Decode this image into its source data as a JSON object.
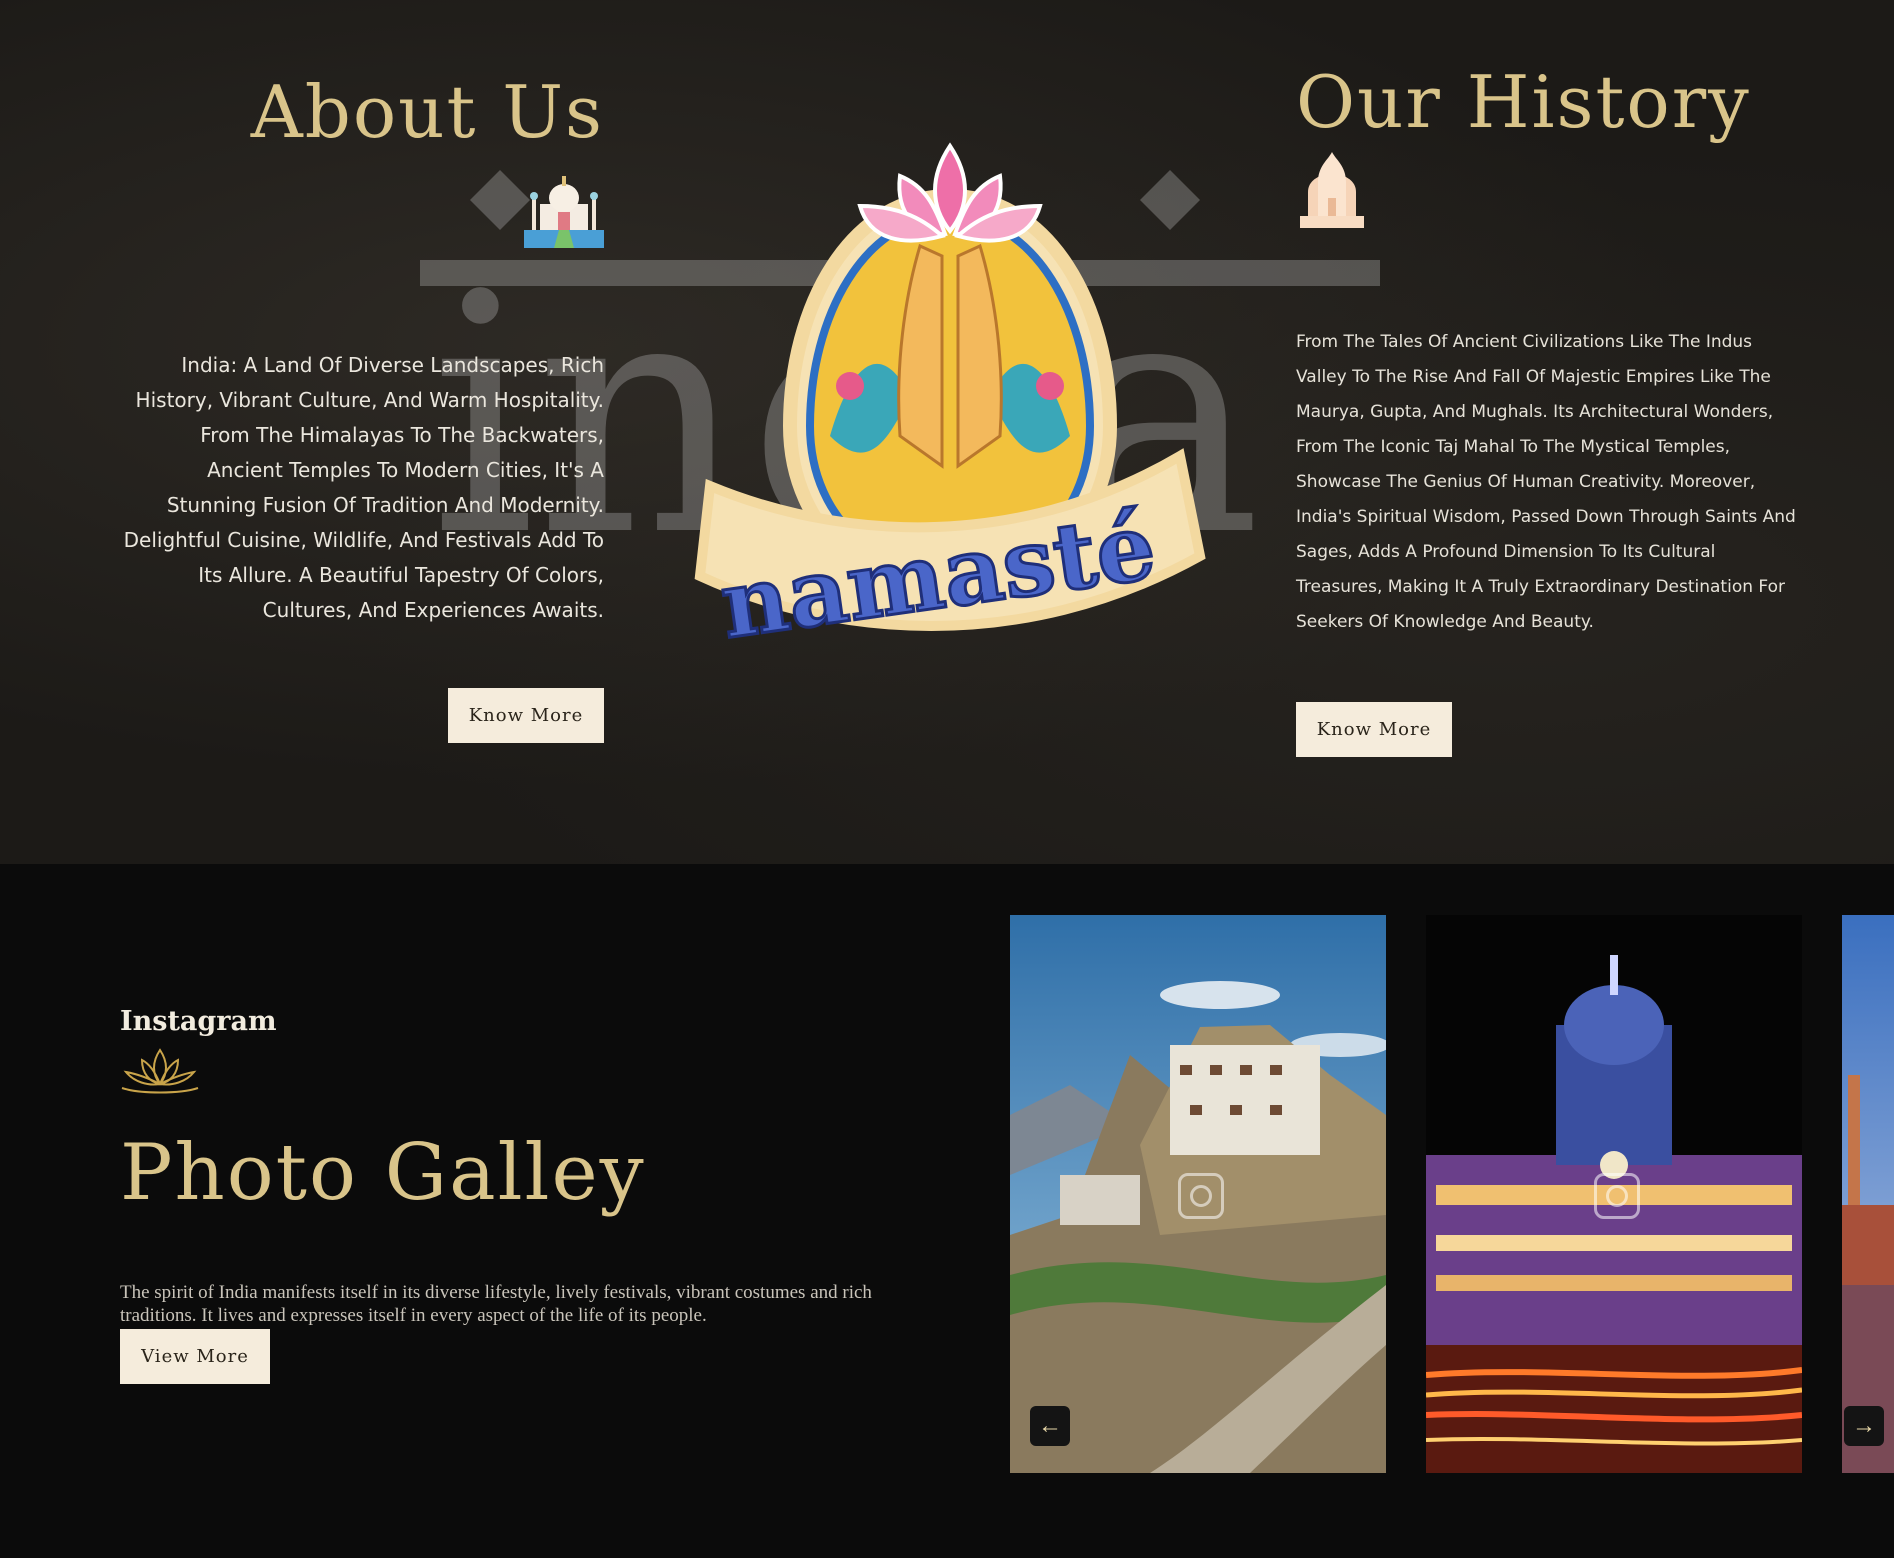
{
  "about": {
    "title": "About Us",
    "icon": "taj-mahal-icon",
    "text": "India: A Land Of Diverse Landscapes, Rich History, Vibrant Culture, And Warm Hospitality. From The Himalayas To The Backwaters, Ancient Temples To Modern Cities, It's A Stunning Fusion Of Tradition And Modernity. Delightful Cuisine, Wildlife, And Festivals Add To Its Allure. A Beautiful Tapestry Of Colors, Cultures, And Experiences Awaits.",
    "button_label": "Know More"
  },
  "history": {
    "title": "Our History",
    "icon": "temple-icon",
    "text": "From The Tales Of Ancient Civilizations Like The Indus Valley To The Rise And Fall Of Majestic Empires Like The Maurya, Gupta, And Mughals. Its Architectural Wonders, From The Iconic Taj Mahal To The Mystical Temples, Showcase The Genius Of Human Creativity. Moreover, India's Spiritual Wisdom, Passed Down Through Saints And Sages, Adds A Profound Dimension To Its Cultural Treasures, Making It A Truly Extraordinary Destination For Seekers Of Knowledge And Beauty.",
    "button_label": "Know More"
  },
  "center": {
    "watermark_text": "india",
    "sticker_text": "namasté"
  },
  "gallery": {
    "label": "Instagram",
    "title": "Photo Galley",
    "description": "The spirit of India manifests itself in its diverse lifestyle, lively festivals, vibrant costumes and rich traditions. It lives and expresses itself in every aspect of the life of its people.",
    "button_label": "View More",
    "arrow_left": "←",
    "arrow_right": "→"
  },
  "colors": {
    "gold": "#d9c48a",
    "button_bg": "#f5ecdc",
    "dark_bg": "#0b0b0b"
  }
}
